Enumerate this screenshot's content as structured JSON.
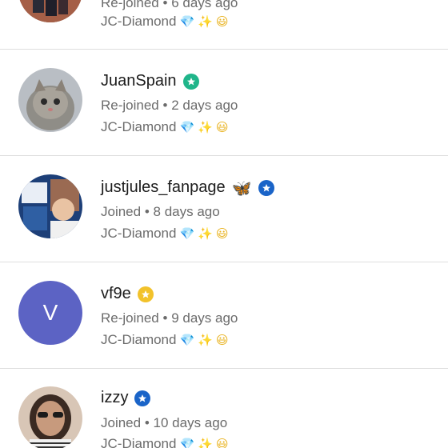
{
  "members": [
    {
      "name": "",
      "status": "Re-joined",
      "time": "6 days ago",
      "tier": "JC-Diamond",
      "avatar_type": "photo",
      "badge_color": ""
    },
    {
      "name": "JuanSpain",
      "status": "Re-joined",
      "time": "2 days ago",
      "tier": "JC-Diamond",
      "avatar_type": "photo-kitten",
      "badge_color": "#20b58a",
      "badge_icon": "star-badge-icon"
    },
    {
      "name": "justjules_fanpage",
      "name_emoji": "butterfly",
      "status": "Joined",
      "time": "8 days ago",
      "tier": "JC-Diamond",
      "avatar_type": "photo-collage",
      "badge_color": "#1a64c8",
      "badge_icon": "star-badge-icon"
    },
    {
      "name": "vf9e",
      "status": "Re-joined",
      "time": "9 days ago",
      "tier": "JC-Diamond",
      "avatar_type": "letter",
      "avatar_letter": "V",
      "avatar_color": "#5c63c4",
      "badge_color": "#f2c22b",
      "badge_icon": "star-badge-icon"
    },
    {
      "name": "izzy",
      "status": "Joined",
      "time": "10 days ago",
      "tier": "JC-Diamond",
      "avatar_type": "photo-person",
      "badge_color": "#1a64c8",
      "badge_icon": "star-badge-icon"
    }
  ],
  "separator": "•"
}
